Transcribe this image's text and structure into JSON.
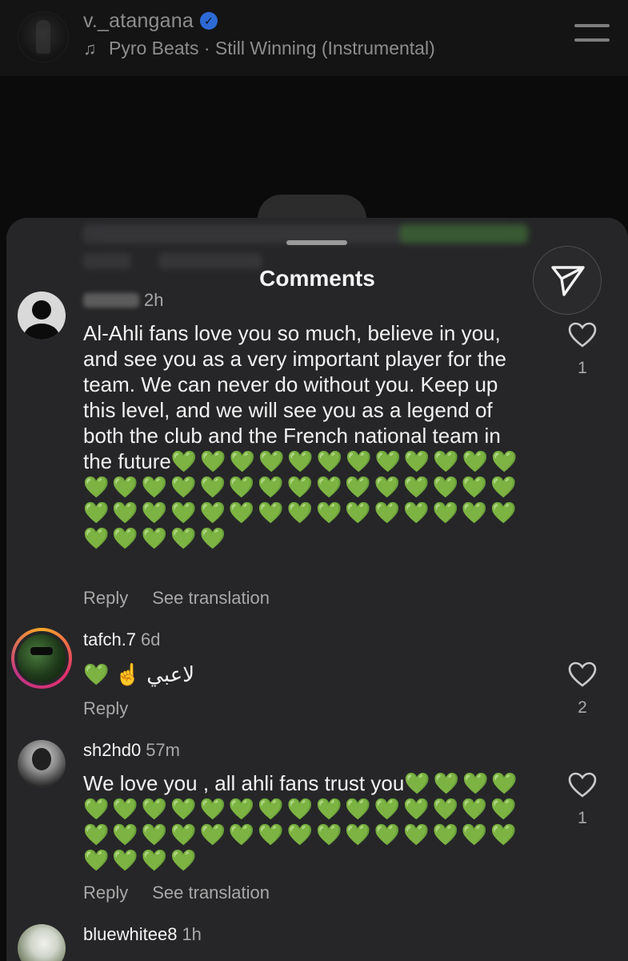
{
  "header": {
    "username": "v._atangana",
    "music": "Pyro Beats · Still Winning (Instrumental)"
  },
  "sheet": {
    "title": "Comments"
  },
  "comments": [
    {
      "time": "2h",
      "text": "Al-Ahli fans love you so much, believe in you, and see you as a very important player for the team. We can never do without you. Keep up this level, and we will see you as a legend of both the club and the French national team in the future",
      "hearts": "💚💚💚💚💚💚💚💚💚💚💚💚💚💚💚💚💚💚💚💚💚💚💚💚💚💚💚💚💚💚💚💚💚💚💚💚💚💚💚💚💚💚💚💚💚💚💚",
      "reply": "Reply",
      "translate": "See translation",
      "likes": "1"
    },
    {
      "username": "tafch.7",
      "time": "6d",
      "text": "💚 ☝️ لاعبي",
      "reply": "Reply",
      "likes": "2"
    },
    {
      "username": "sh2hd0",
      "time": "57m",
      "text": "We love you , all ahli fans trust you",
      "hearts": "💚💚💚💚💚💚💚💚💚💚💚💚💚💚💚💚💚💚💚💚💚💚💚💚💚💚💚💚💚💚💚💚💚💚💚💚💚💚",
      "reply": "Reply",
      "translate": "See translation",
      "likes": "1"
    },
    {
      "username": "bluewhitee8",
      "time": "1h"
    }
  ],
  "icons": {
    "verified": "verified-badge-icon",
    "music": "music-note-icon",
    "menu": "menu-icon",
    "share": "send-icon",
    "like": "heart-outline-icon"
  },
  "colors": {
    "sheet_bg": "#262628",
    "heart_green": "#4fc34f",
    "verified_blue": "#2d6ad6",
    "muted_text": "#a8a8a8"
  }
}
